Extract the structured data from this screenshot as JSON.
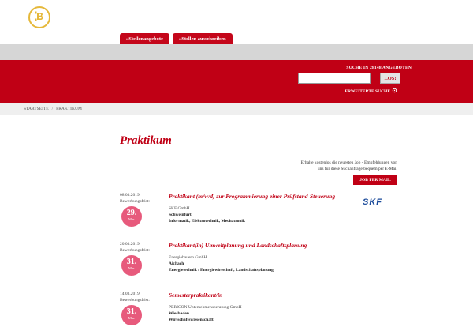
{
  "tabs": [
    {
      "label": "»Stellenangebote"
    },
    {
      "label": "»Stellen ausschreiben"
    }
  ],
  "search": {
    "title": "SUCHE IN 28148 ANGEBOTEN",
    "value": "",
    "button_label": "LOS!",
    "advanced_label": "ERWEITERTE SUCHE"
  },
  "breadcrumb": {
    "home": "STARTSEITE",
    "separator": "/",
    "current": "PRAKTIKUM"
  },
  "page_title": "Praktikum",
  "promo": {
    "text_line1": "Erhalte kostenlos die neuesten Job - Empfehlungen von",
    "text_line2": "uns für diese Suchanfrage bequem per E-Mail",
    "button_label": "JOB PER MAIL"
  },
  "jobs": [
    {
      "date": "08.03.2019",
      "deadline_label": "Bewerbungsfrist:",
      "deadline_day": "29.",
      "deadline_month": "Mar.",
      "title": "Praktikant (m/w/d) zur Programmierung einer Prüfstand-Steuerung",
      "company": "SKF GmbH",
      "city": "Schweinfurt",
      "field": "Informatik, Elektrotechnik, Mechatronik",
      "logo_text": "SKF"
    },
    {
      "date": "20.03.2019",
      "deadline_label": "Bewerbungsfrist:",
      "deadline_day": "31.",
      "deadline_month": "Mar.",
      "title": "Praktikant(in) Umweltplanung und Landschaftsplanung",
      "company": "Energiebauern GmbH",
      "city": "Aichach",
      "field": "Energietechnik / Energiewirtschaft, Landschaftsplanung"
    },
    {
      "date": "14.03.2019",
      "deadline_label": "Bewerbungsfrist:",
      "deadline_day": "31.",
      "deadline_month": "Mar.",
      "title": "Semesterpraktikant/in",
      "company": "PERICON Unternehmensberatung GmbH",
      "city": "Wiesbaden",
      "field": "Wirtschaftswissenschaft"
    }
  ],
  "colors": {
    "brand_red": "#c00015",
    "badge_pink": "#e75a7c",
    "logo_gold": "#e5b83a",
    "skf_blue": "#1a4a9a"
  }
}
